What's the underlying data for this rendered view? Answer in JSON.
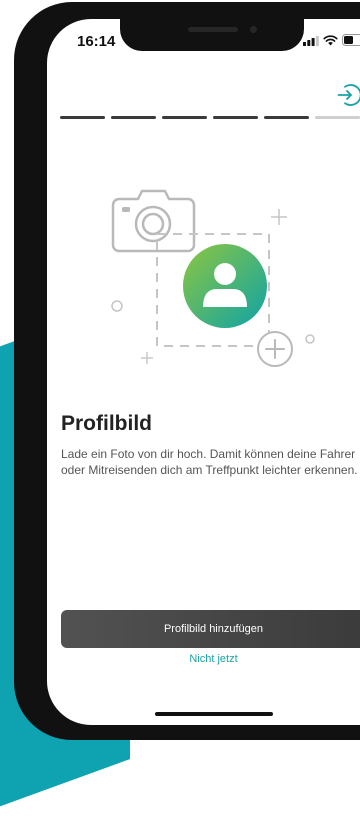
{
  "status_bar": {
    "time": "16:14"
  },
  "progress": {
    "total": 6,
    "completed": 5
  },
  "content": {
    "title": "Profilbild",
    "description": "Lade ein Foto von dir hoch. Damit können deine Fahrer oder Mitreisenden dich am Treffpunkt leichter erkennen."
  },
  "actions": {
    "primary_label": "Profilbild hinzufügen",
    "secondary_label": "Nicht jetzt"
  },
  "icons": {
    "header_action": "login-icon",
    "illustration": "camera-profile-illustration"
  },
  "colors": {
    "accent": "#1aa3a7",
    "brand_background": "#0fa3b1",
    "avatar_gradient_start": "#8dc63f",
    "avatar_gradient_end": "#0fa3a7",
    "button_dark": "#4a4a4a"
  }
}
